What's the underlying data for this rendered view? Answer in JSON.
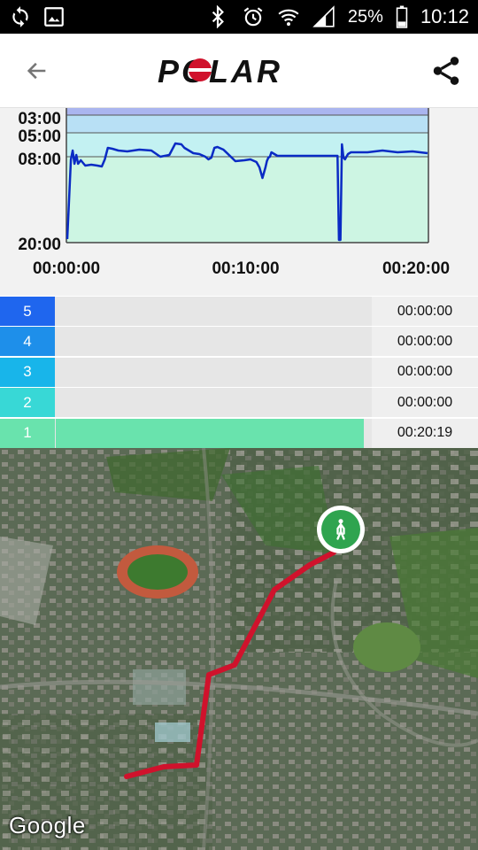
{
  "status_bar": {
    "battery": "25%",
    "time": "10:12",
    "icons": [
      "sync-icon",
      "image-icon",
      "bluetooth-icon",
      "alarm-icon",
      "wifi-icon",
      "signal-icon",
      "battery-icon"
    ]
  },
  "app_bar": {
    "logo_text": "POLAR",
    "back_icon": "arrow-left-icon",
    "share_icon": "share-icon"
  },
  "chart_data": {
    "type": "line",
    "title": "",
    "y_tick_labels": [
      "03:00",
      "05:00",
      "08:00",
      "20:00"
    ],
    "x_tick_labels": [
      "00:00:00",
      "00:10:00",
      "00:20:00"
    ],
    "x_range_seconds": [
      0,
      1200
    ],
    "series": [
      {
        "x": [
          0,
          12,
          18,
          24,
          30,
          36,
          45,
          60,
          80,
          100,
          115,
          125,
          135,
          150,
          170,
          200,
          240,
          280,
          310,
          340,
          360,
          380,
          390,
          400,
          420,
          440,
          460,
          470,
          480,
          490,
          500,
          520,
          560,
          590,
          610,
          630,
          640,
          650,
          660,
          665,
          670,
          675,
          680,
          690,
          700,
          720,
          760,
          800,
          840,
          880,
          900,
          905,
          910,
          915,
          920,
          925,
          935,
          945,
          960,
          1000,
          1050,
          1100,
          1150,
          1200
        ],
        "y": [
          19.6,
          10.6,
          9.6,
          11.1,
          10.1,
          11.1,
          10.7,
          11.3,
          11.2,
          11.3,
          11.4,
          10.6,
          9.3,
          9.4,
          9.6,
          9.7,
          9.5,
          9.6,
          10.3,
          10.1,
          8.8,
          8.9,
          9.3,
          9.5,
          9.9,
          10.0,
          10.3,
          10.6,
          10.4,
          9.3,
          9.2,
          9.5,
          10.8,
          10.7,
          10.6,
          10.9,
          11.5,
          12.7,
          11.5,
          10.8,
          10.4,
          10.3,
          9.8,
          10.0,
          10.2,
          10.2,
          10.2,
          10.2,
          10.2,
          10.2,
          10.2,
          19.7,
          19.7,
          8.9,
          10.4,
          10.6,
          10.0,
          9.8,
          9.8,
          9.8,
          9.6,
          9.8,
          9.7,
          9.9
        ]
      }
    ]
  },
  "zones": [
    {
      "label": "5",
      "time": "00:00:00",
      "color": "#1f66ee",
      "fill": 0
    },
    {
      "label": "4",
      "time": "00:00:00",
      "color": "#1e8fea",
      "fill": 0
    },
    {
      "label": "3",
      "time": "00:00:00",
      "color": "#18b5ea",
      "fill": 0
    },
    {
      "label": "2",
      "time": "00:00:00",
      "color": "#38d8d6",
      "fill": 0
    },
    {
      "label": "1",
      "time": "00:20:19",
      "color": "#69e3ad",
      "fill": 1.0
    }
  ],
  "map": {
    "attribution": "Google",
    "marker_icon": "walking-person-icon",
    "route_color": "#d0122c"
  }
}
